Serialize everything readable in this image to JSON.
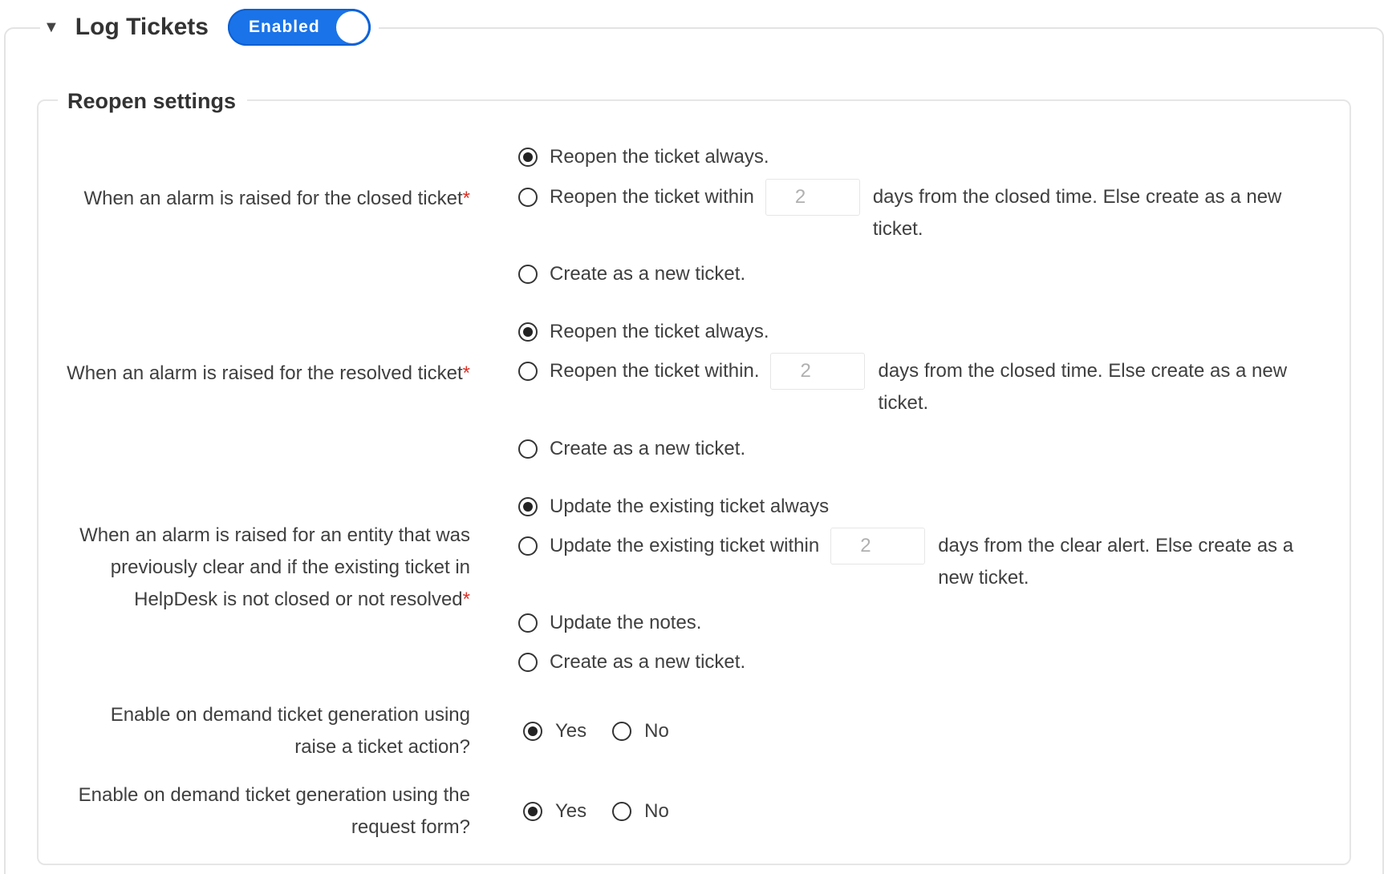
{
  "section": {
    "title": "Log Tickets",
    "toggle_label": "Enabled",
    "toggle_on": true
  },
  "reopen": {
    "title": "Reopen settings",
    "required_mark": "*",
    "closed": {
      "label": "When an alarm is raised for the closed ticket",
      "opt1": "Reopen the ticket always.",
      "opt2_before": "Reopen the ticket within",
      "opt2_value": "2",
      "opt2_after": "days from the closed time. Else create as a new ticket.",
      "opt3": "Create as a new ticket.",
      "selected": 1
    },
    "resolved": {
      "label": "When an alarm is raised for the resolved ticket",
      "opt1": "Reopen the ticket always.",
      "opt2_before": "Reopen the ticket within.",
      "opt2_value": "2",
      "opt2_after": "days from the closed time. Else create as a new ticket.",
      "opt3": "Create as a new ticket.",
      "selected": 1
    },
    "cleared": {
      "label": "When an alarm is raised for an entity that was previously clear and if the existing ticket in HelpDesk is not closed or not resolved",
      "opt1": "Update the existing ticket always",
      "opt2_before": "Update the existing ticket within",
      "opt2_value": "2",
      "opt2_after": "days from the clear alert. Else create as a new ticket.",
      "opt3": "Update the notes.",
      "opt4": "Create as a new ticket.",
      "selected": 1
    },
    "raise_action": {
      "label": "Enable on demand ticket generation using raise a ticket action?",
      "yes": "Yes",
      "no": "No",
      "selected": "Yes"
    },
    "request_form": {
      "label": "Enable on demand ticket generation using the request form?",
      "yes": "Yes",
      "no": "No",
      "selected": "Yes"
    }
  }
}
